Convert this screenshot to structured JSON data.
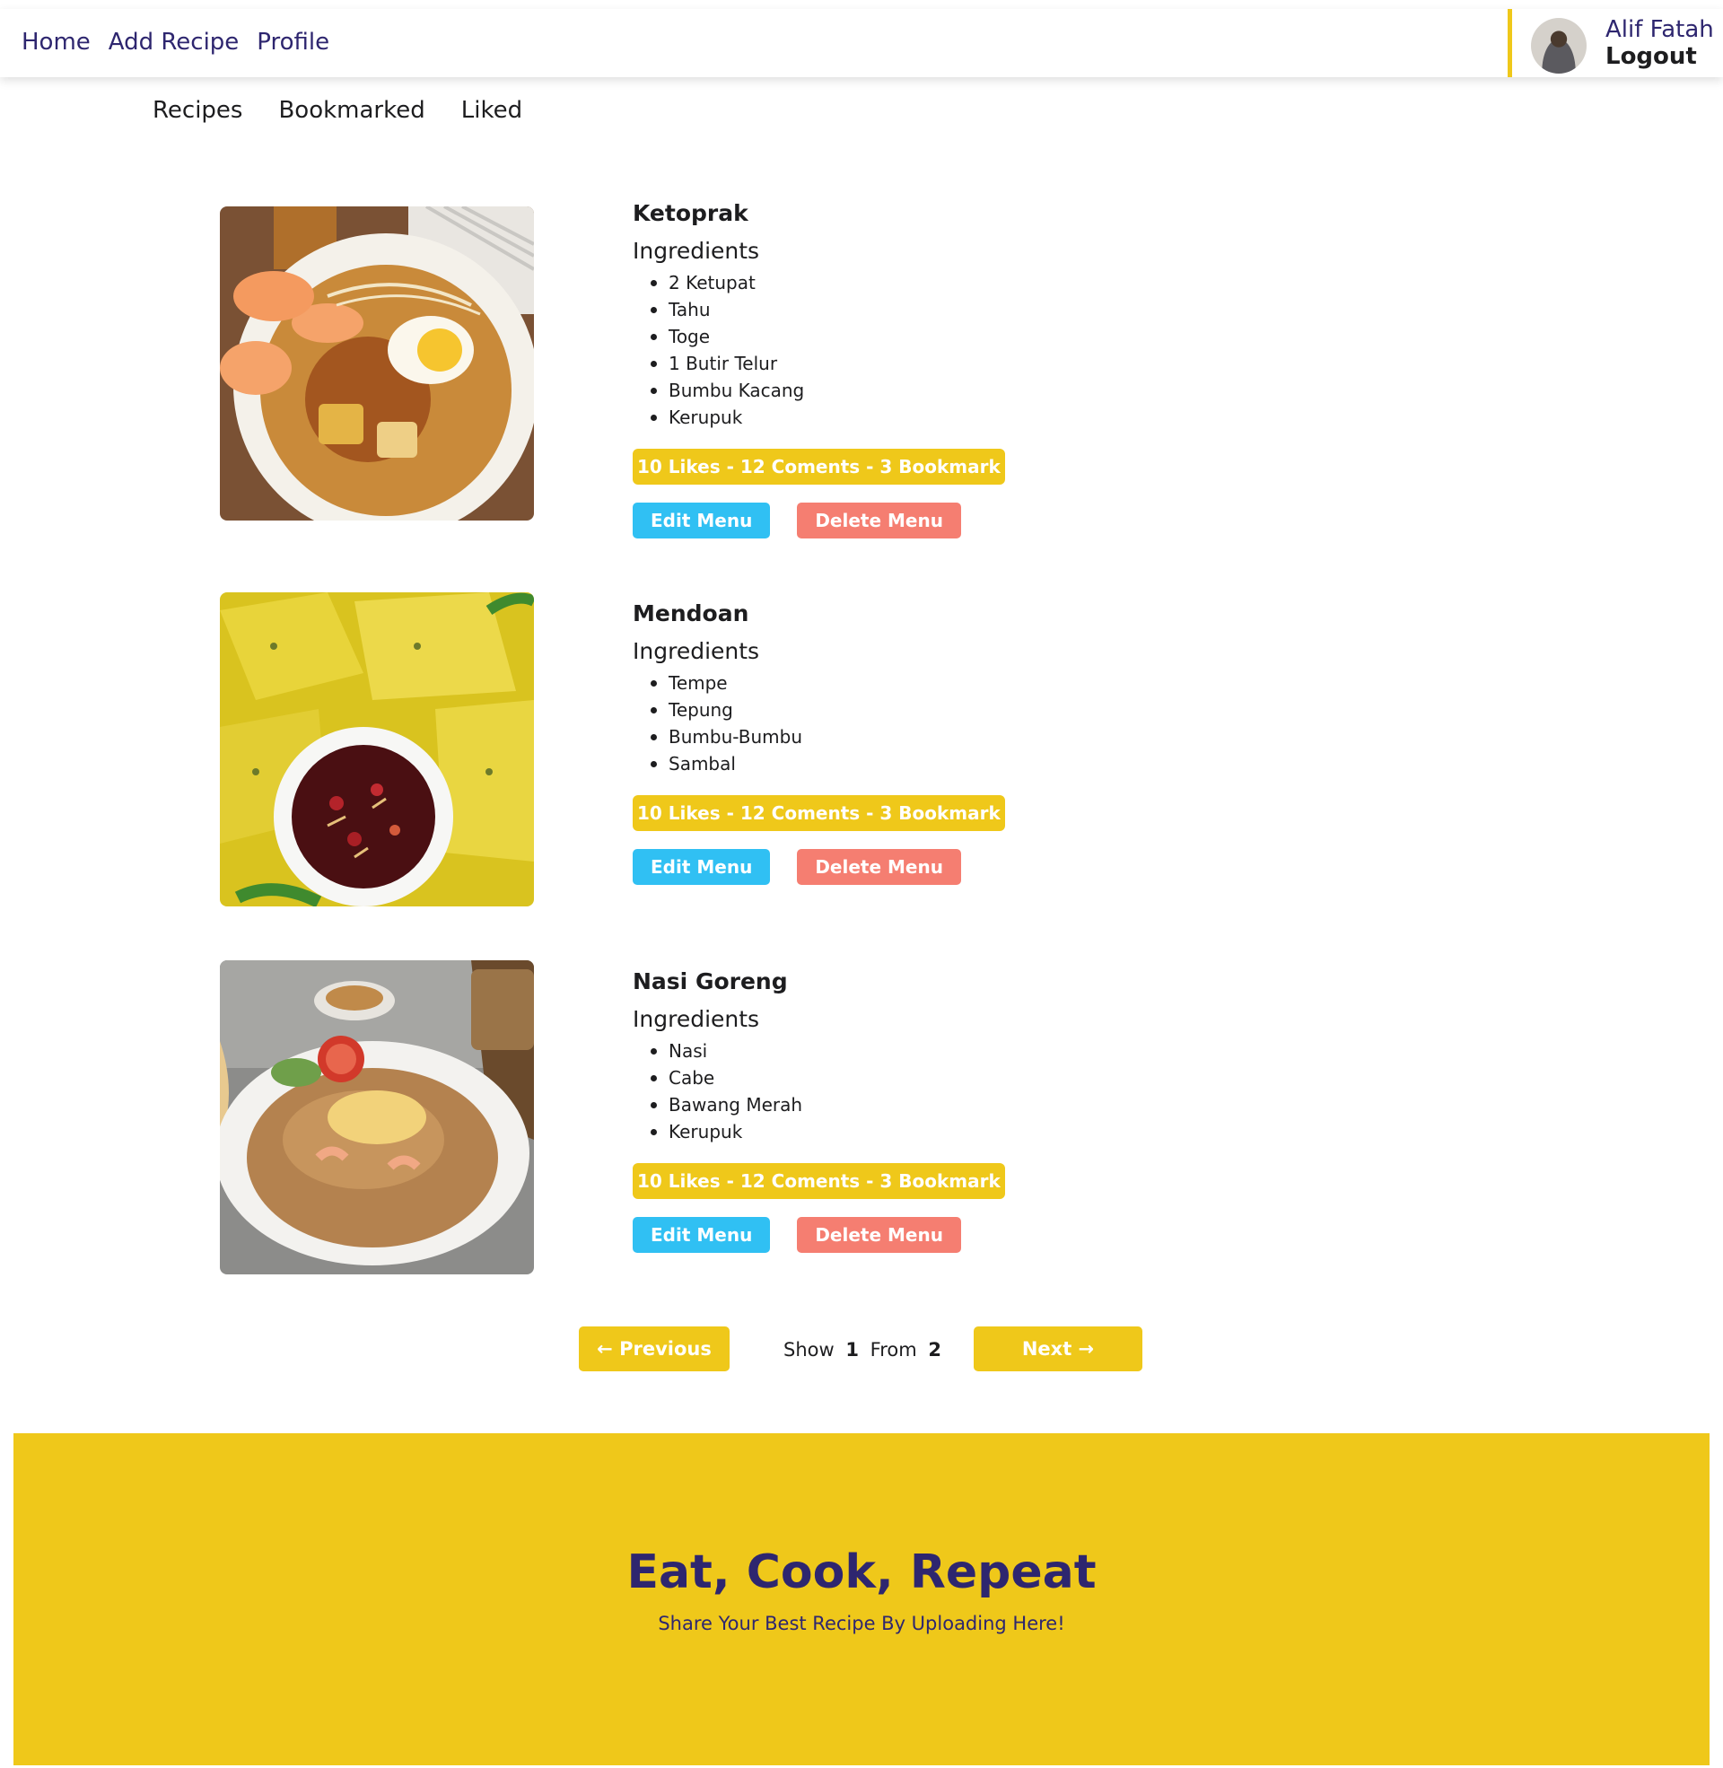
{
  "nav": {
    "links": [
      "Home",
      "Add Recipe",
      "Profile"
    ],
    "user_name": "Alif Fatah",
    "logout_label": "Logout"
  },
  "tabs": [
    "Recipes",
    "Bookmarked",
    "Liked"
  ],
  "recipes": [
    {
      "title": "Ketoprak",
      "ingredients_heading": "Ingredients",
      "ingredients": [
        "2 Ketupat",
        "Tahu",
        "Toge",
        "1 Butir Telur",
        "Bumbu Kacang",
        "Kerupuk"
      ],
      "stats": "10 Likes - 12 Coments - 3 Bookmark",
      "edit_label": "Edit Menu",
      "delete_label": "Delete Menu"
    },
    {
      "title": "Mendoan",
      "ingredients_heading": "Ingredients",
      "ingredients": [
        "Tempe",
        "Tepung",
        "Bumbu-Bumbu",
        "Sambal"
      ],
      "stats": "10 Likes - 12 Coments - 3 Bookmark",
      "edit_label": "Edit Menu",
      "delete_label": "Delete Menu"
    },
    {
      "title": "Nasi Goreng",
      "ingredients_heading": "Ingredients",
      "ingredients": [
        "Nasi",
        "Cabe",
        "Bawang Merah",
        "Kerupuk"
      ],
      "stats": "10 Likes - 12 Coments - 3 Bookmark",
      "edit_label": "Edit Menu",
      "delete_label": "Delete Menu"
    }
  ],
  "pagination": {
    "previous_label": "Previous",
    "next_label": "Next",
    "show_label": "Show",
    "current_page": "1",
    "from_label": "From",
    "total_pages": "2"
  },
  "footer": {
    "title": "Eat, Cook, Repeat",
    "subtitle": "Share Your Best Recipe By Uploading Here!"
  },
  "colors": {
    "accent_yellow": "#efc81a",
    "nav_text": "#2e266f",
    "edit_button": "#30c0f3",
    "delete_button": "#f57e71"
  },
  "icons": [
    "avatar",
    "arrow-left-icon",
    "arrow-right-icon"
  ]
}
